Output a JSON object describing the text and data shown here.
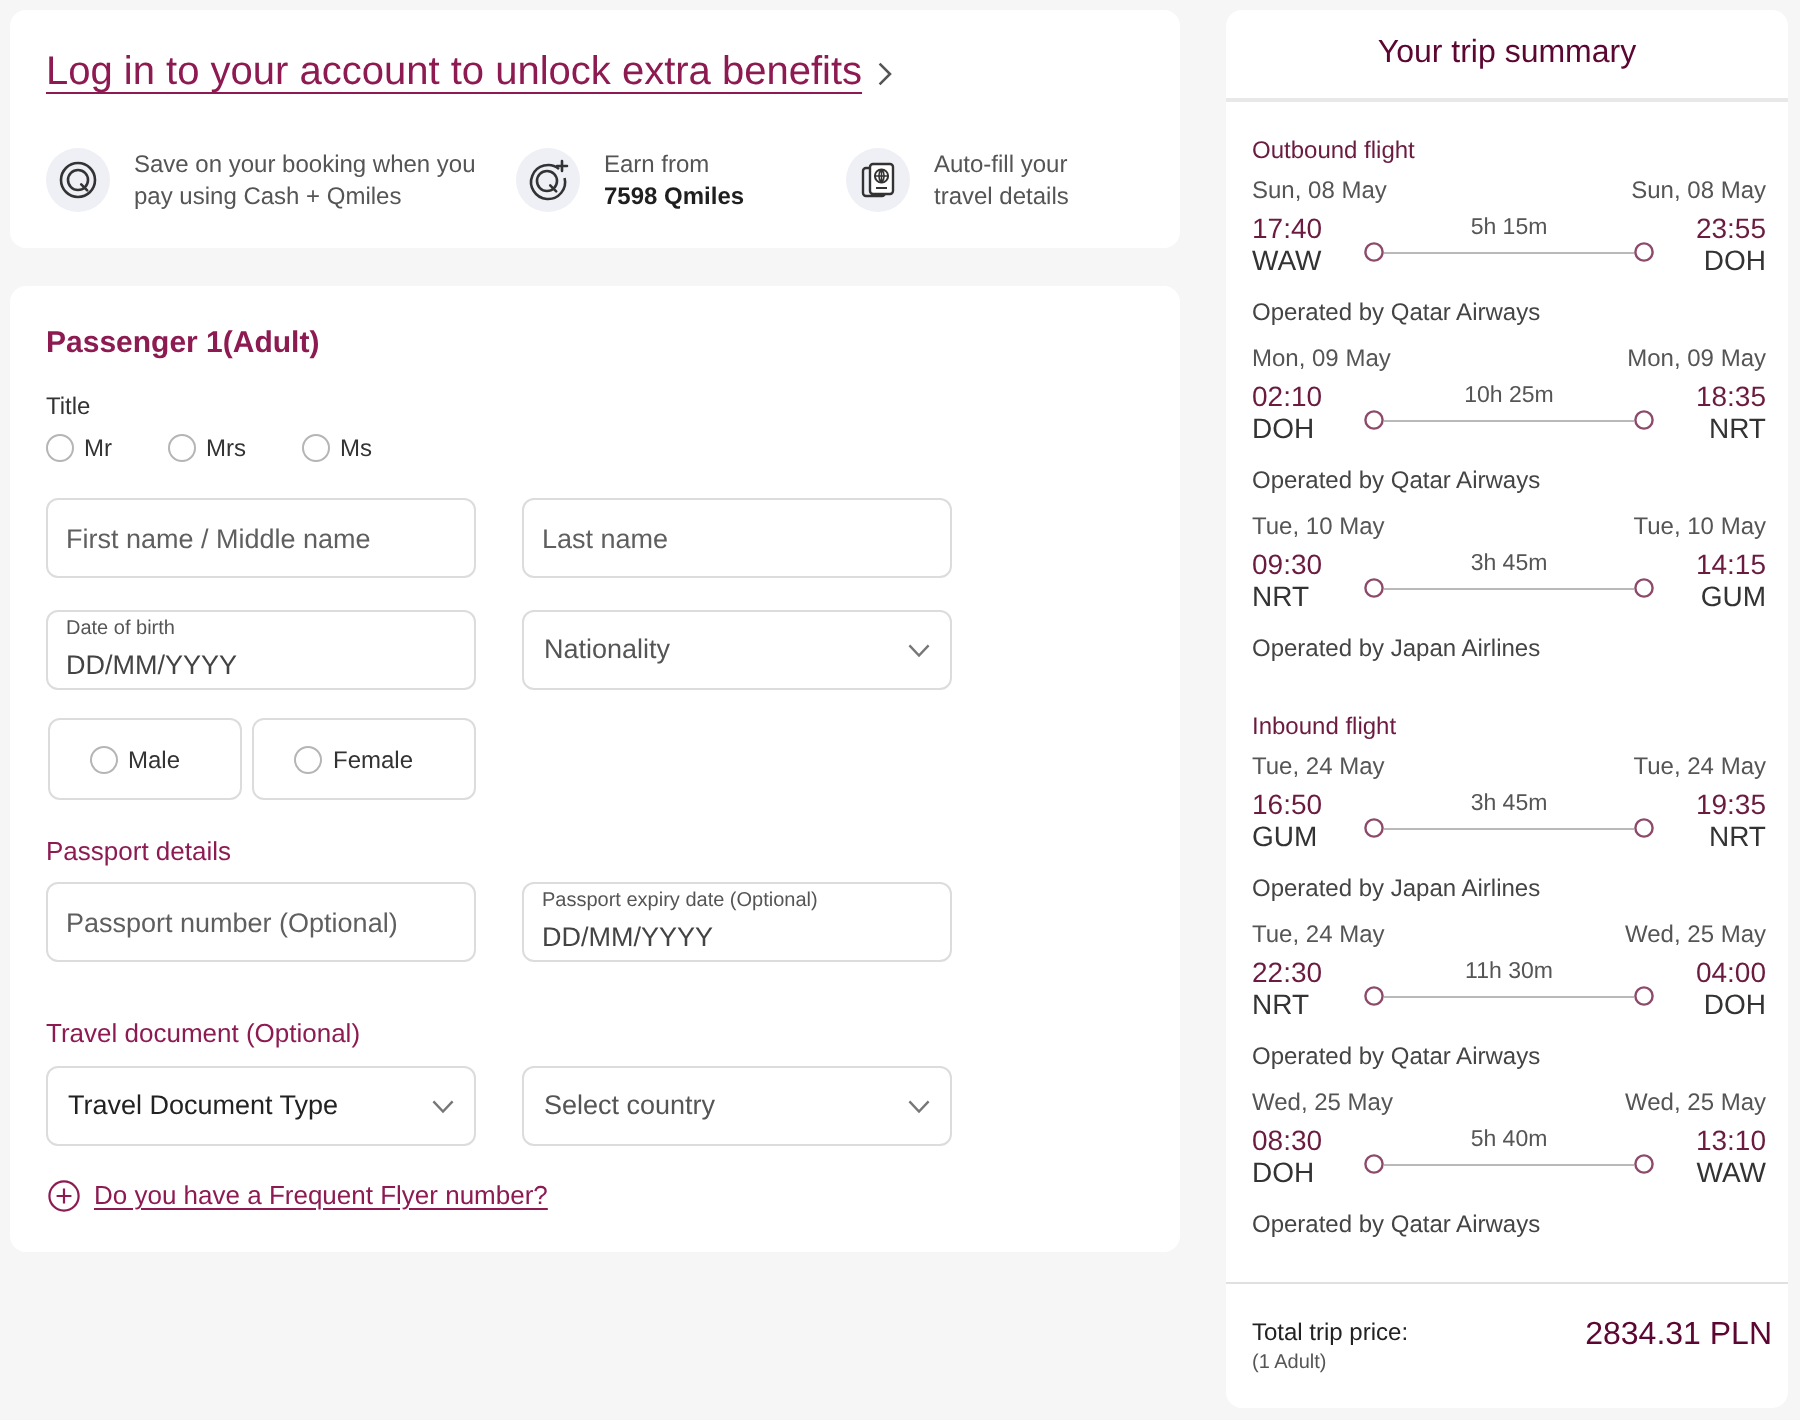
{
  "login_banner": {
    "link": "Log in to your account to unlock extra benefits",
    "benefits": [
      {
        "text": "Save on your booking when you pay using Cash + Qmiles"
      },
      {
        "text": "Earn from",
        "highlight": "7598 Qmiles"
      },
      {
        "text": "Auto-fill your travel details"
      }
    ]
  },
  "passenger": {
    "heading": "Passenger 1(Adult)",
    "title_group": {
      "label": "Title",
      "options": [
        {
          "label": "Mr",
          "selected": false
        },
        {
          "label": "Mrs",
          "selected": false
        },
        {
          "label": "Ms",
          "selected": false
        }
      ]
    },
    "rows": [
      [
        {
          "kind": "text",
          "placeholder": "First name / Middle name"
        },
        {
          "kind": "text",
          "placeholder": "Last name"
        }
      ],
      [
        {
          "kind": "date",
          "label": "Date of birth",
          "placeholder": "DD/MM/YYYY"
        },
        {
          "kind": "select",
          "placeholder": "Nationality"
        }
      ]
    ],
    "gender_options": [
      {
        "label": "Male",
        "selected": false
      },
      {
        "label": "Female",
        "selected": false
      }
    ],
    "sections": [
      {
        "heading": "Passport details",
        "fields": [
          {
            "kind": "text",
            "placeholder": "Passport number (Optional)"
          },
          {
            "kind": "date",
            "label": "Passport expiry date (Optional)",
            "placeholder": "DD/MM/YYYY"
          }
        ]
      },
      {
        "heading": "Travel document (Optional)",
        "fields": [
          {
            "kind": "select",
            "value": "Travel Document Type"
          },
          {
            "kind": "select",
            "placeholder": "Select country"
          }
        ]
      }
    ],
    "frequent_flyer_link": "Do you have a Frequent Flyer number?"
  },
  "trip_summary": {
    "title": "Your trip summary",
    "journeys": [
      {
        "heading": "Outbound flight",
        "segments": [
          {
            "depart_date": "Sun, 08 May",
            "arrive_date": "Sun, 08 May",
            "depart_time": "17:40",
            "arrive_time": "23:55",
            "origin": "WAW",
            "destination": "DOH",
            "duration": "5h 15m",
            "operator": "Operated by Qatar Airways"
          },
          {
            "depart_date": "Mon, 09 May",
            "arrive_date": "Mon, 09 May",
            "depart_time": "02:10",
            "arrive_time": "18:35",
            "origin": "DOH",
            "destination": "NRT",
            "duration": "10h 25m",
            "operator": "Operated by Qatar Airways"
          },
          {
            "depart_date": "Tue, 10 May",
            "arrive_date": "Tue, 10 May",
            "depart_time": "09:30",
            "arrive_time": "14:15",
            "origin": "NRT",
            "destination": "GUM",
            "duration": "3h 45m",
            "operator": "Operated by Japan Airlines"
          }
        ]
      },
      {
        "heading": "Inbound flight",
        "segments": [
          {
            "depart_date": "Tue, 24 May",
            "arrive_date": "Tue, 24 May",
            "depart_time": "16:50",
            "arrive_time": "19:35",
            "origin": "GUM",
            "destination": "NRT",
            "duration": "3h 45m",
            "operator": "Operated by Japan Airlines"
          },
          {
            "depart_date": "Tue, 24 May",
            "arrive_date": "Wed, 25 May",
            "depart_time": "22:30",
            "arrive_time": "04:00",
            "origin": "NRT",
            "destination": "DOH",
            "duration": "11h 30m",
            "operator": "Operated by Qatar Airways"
          },
          {
            "depart_date": "Wed, 25 May",
            "arrive_date": "Wed, 25 May",
            "depart_time": "08:30",
            "arrive_time": "13:10",
            "origin": "DOH",
            "destination": "WAW",
            "duration": "5h 40m",
            "operator": "Operated by Qatar Airways"
          }
        ]
      }
    ],
    "total": {
      "label": "Total trip price:",
      "note": "(1 Adult)",
      "price": "2834.31 PLN"
    }
  }
}
